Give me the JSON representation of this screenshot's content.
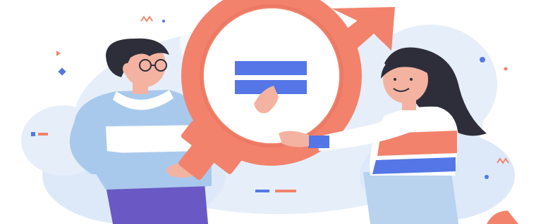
{
  "illustration": {
    "subject": "gender-equality",
    "colors": {
      "background": "#ffffff",
      "blob": "#dde9f8",
      "blob_dark": "#c9dcf3",
      "symbol": "#f2826b",
      "symbol_shadow": "#e06a55",
      "equals": "#5476e6",
      "man_sweater": "#a9c9ec",
      "man_collar": "#ffffff",
      "man_pants": "#6a58c4",
      "hair": "#2e2e3a",
      "skin": "#f4b3a1",
      "woman_jeans": "#b9d2ee",
      "stripe_orange": "#f2826b",
      "stripe_white": "#ffffff",
      "stripe_blue": "#5476e6"
    },
    "icons": [
      "male-symbol-icon",
      "female-symbol-icon",
      "equals-sign-icon",
      "sparkle-icon"
    ]
  }
}
